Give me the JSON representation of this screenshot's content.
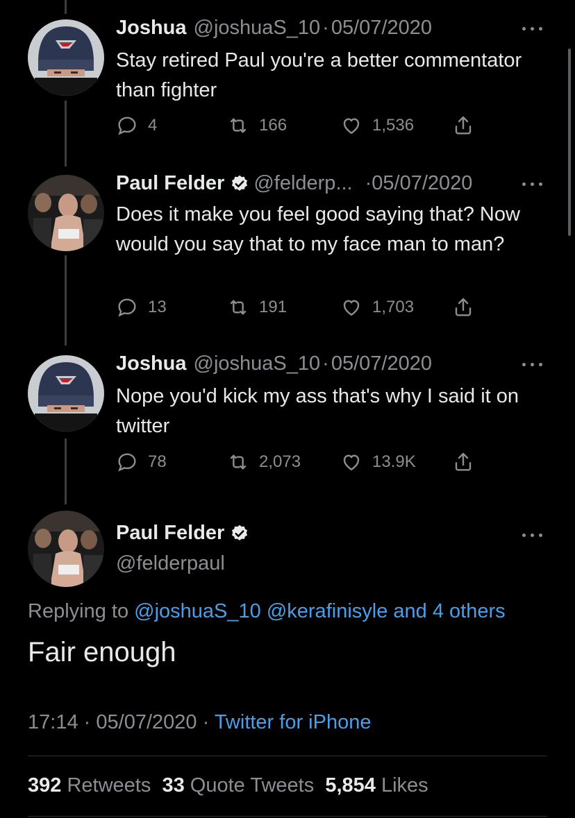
{
  "tweets": [
    {
      "name": "Joshua",
      "handle": "@joshuaS_10",
      "sep": "·",
      "date": "05/07/2020",
      "text": "Stay retired Paul you're a better commentator than fighter",
      "replies": "4",
      "retweets": "166",
      "likes": "1,536",
      "avatar_icon": "beanie-avatar"
    },
    {
      "name": "Paul Felder",
      "handle": "@felderp...",
      "sep": "·",
      "date": "05/07/2020",
      "text": "Does it make you feel good saying that? Now would you say that to my face man to man?",
      "replies": "13",
      "retweets": "191",
      "likes": "1,703",
      "avatar_icon": "fighter-avatar"
    },
    {
      "name": "Joshua",
      "handle": "@joshuaS_10",
      "sep": "·",
      "date": "05/07/2020",
      "text": "Nope you'd kick my ass that's why I said it on twitter",
      "replies": "78",
      "retweets": "2,073",
      "likes": "13.9K",
      "avatar_icon": "beanie-avatar"
    }
  ],
  "focal": {
    "name": "Paul Felder",
    "handle": "@felderpaul",
    "replying_prefix": "Replying to ",
    "replying_mentions": "@joshuaS_10 @kerafinisyle and 4 others",
    "text": "Fair enough",
    "time": "17:14",
    "sep": "·",
    "date": "05/07/2020",
    "source": "Twitter for iPhone",
    "retweets_count": "392",
    "retweets_label": "Retweets",
    "quotes_count": "33",
    "quotes_label": "Quote Tweets",
    "likes_count": "5,854",
    "likes_label": "Likes"
  },
  "colors": {
    "background": "#000000",
    "text": "#e7e9ea",
    "secondary": "#8b8f94",
    "link": "#4a9fe8",
    "verified": "#e7e9ea"
  }
}
